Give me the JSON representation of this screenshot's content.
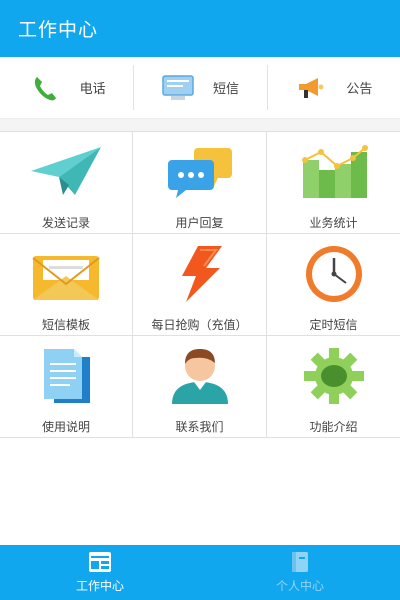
{
  "header": {
    "title": "工作中心"
  },
  "quickbar": {
    "items": [
      {
        "label": "电话",
        "icon": "phone-icon"
      },
      {
        "label": "短信",
        "icon": "sms-monitor-icon"
      },
      {
        "label": "公告",
        "icon": "megaphone-icon"
      }
    ]
  },
  "grid": {
    "items": [
      {
        "label": "发送记录",
        "icon": "paper-plane-icon"
      },
      {
        "label": "用户回复",
        "icon": "chat-bubbles-icon"
      },
      {
        "label": "业务统计",
        "icon": "bar-chart-icon"
      },
      {
        "label": "短信模板",
        "icon": "envelope-icon"
      },
      {
        "label": "每日抢购（充值）",
        "icon": "lightning-icon"
      },
      {
        "label": "定时短信",
        "icon": "clock-icon"
      },
      {
        "label": "使用说明",
        "icon": "document-icon"
      },
      {
        "label": "联系我们",
        "icon": "user-icon"
      },
      {
        "label": "功能介绍",
        "icon": "gear-icon"
      }
    ]
  },
  "tabbar": {
    "items": [
      {
        "label": "工作中心",
        "icon": "workspace-icon",
        "active": true
      },
      {
        "label": "个人中心",
        "icon": "profile-book-icon",
        "active": false
      }
    ]
  },
  "colors": {
    "brand": "#11a7ee",
    "inactive_tab_text": "#8fd3f5"
  }
}
